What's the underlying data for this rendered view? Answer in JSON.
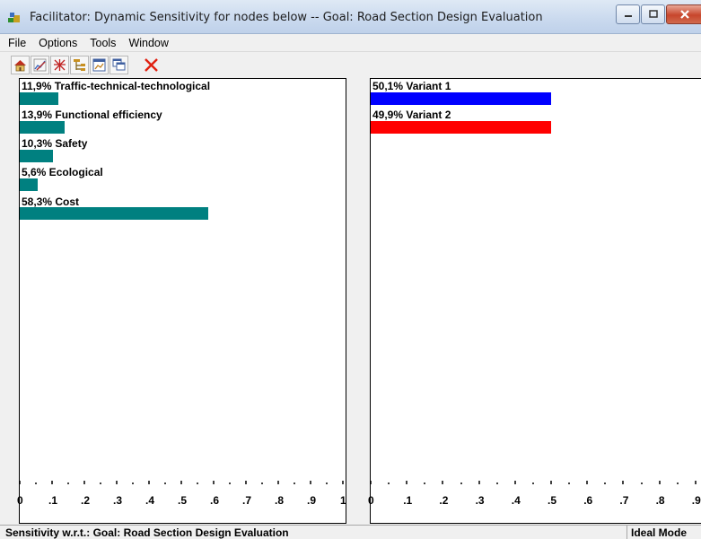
{
  "window": {
    "title": "Facilitator: Dynamic Sensitivity for nodes below -- Goal: Road Section Design Evaluation"
  },
  "menu": [
    "File",
    "Options",
    "Tools",
    "Window"
  ],
  "toolbar": {
    "buttons": [
      "home-icon",
      "edit-chart-icon",
      "scatter-icon",
      "tree-icon",
      "chart-window-icon",
      "cascade-windows-icon",
      "delete-icon"
    ]
  },
  "chart_data": [
    {
      "type": "bar",
      "orientation": "horizontal",
      "categories": [
        "Traffic-technical-technological",
        "Functional efficiency",
        "Safety",
        "Ecological",
        "Cost"
      ],
      "labels": [
        "11,9% Traffic-technical-technological",
        "13,9% Functional efficiency",
        "10,3% Safety",
        "5,6% Ecological",
        "58,3% Cost"
      ],
      "values": [
        0.119,
        0.139,
        0.103,
        0.056,
        0.583
      ],
      "colors": [
        "#008080",
        "#008080",
        "#008080",
        "#008080",
        "#008080"
      ],
      "xlim": [
        0,
        1
      ],
      "xticks": [
        "0",
        ".1",
        ".2",
        ".3",
        ".4",
        ".5",
        ".6",
        ".7",
        ".8",
        ".9",
        "1"
      ]
    },
    {
      "type": "bar",
      "orientation": "horizontal",
      "categories": [
        "Variant 1",
        "Variant 2"
      ],
      "labels": [
        "50,1% Variant 1",
        "49,9% Variant 2"
      ],
      "values": [
        0.501,
        0.499
      ],
      "colors": [
        "#0000ff",
        "#ff0000"
      ],
      "xlim": [
        0,
        1
      ],
      "xticks": [
        "0",
        ".1",
        ".2",
        ".3",
        ".4",
        ".5",
        ".6",
        ".7",
        ".8",
        ".9"
      ]
    }
  ],
  "status": {
    "left": "Sensitivity w.r.t.: Goal: Road Section Design Evaluation",
    "right": "Ideal Mode"
  }
}
